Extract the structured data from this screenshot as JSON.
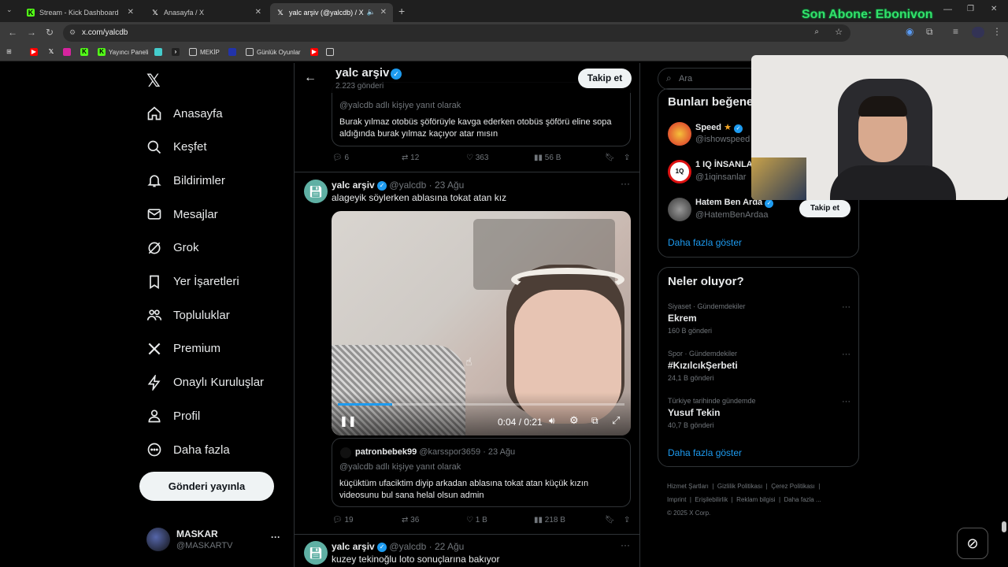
{
  "browser": {
    "tabs": [
      {
        "label": "Stream - Kick Dashboard",
        "active": false
      },
      {
        "label": "Anasayfa / X",
        "active": false
      },
      {
        "label": "yalc arşiv (@yalcdb) / X",
        "active": true
      }
    ],
    "url": "x.com/yalcdb",
    "bookmarks": [
      "Yayıncı Paneli",
      "MEKİP",
      "Günlük Oyunlar"
    ]
  },
  "overlay": {
    "text": "Son Abone: Ebonivon"
  },
  "nav": {
    "items": [
      {
        "label": "Anasayfa",
        "icon": "home-icon"
      },
      {
        "label": "Keşfet",
        "icon": "search-icon"
      },
      {
        "label": "Bildirimler",
        "icon": "bell-icon"
      },
      {
        "label": "Mesajlar",
        "icon": "mail-icon"
      },
      {
        "label": "Grok",
        "icon": "grok-icon"
      },
      {
        "label": "Yer İşaretleri",
        "icon": "bookmark-icon"
      },
      {
        "label": "Topluluklar",
        "icon": "communities-icon"
      },
      {
        "label": "Premium",
        "icon": "x-icon"
      },
      {
        "label": "Onaylı Kuruluşlar",
        "icon": "bolt-icon"
      },
      {
        "label": "Profil",
        "icon": "person-icon"
      },
      {
        "label": "Daha fazla",
        "icon": "more-circle-icon"
      }
    ],
    "post_button": "Gönderi yayınla",
    "account": {
      "name": "MASKAR",
      "handle": "@MASKARTV",
      "more": "···"
    }
  },
  "profile_header": {
    "name": "yalc arşiv",
    "posts": "2.223 gönderi",
    "follow": "Takip et"
  },
  "feed": {
    "post0": {
      "reply_to": "@yalcdb adlı kişiye yanıt olarak",
      "text": "Burak yılmaz otobüs şöförüyle kavga ederken otobüs şöförü eline sopa aldığında burak yılmaz kaçıyor atar mısın",
      "replies": "6",
      "reposts": "12",
      "likes": "363",
      "views": "56 B"
    },
    "post1": {
      "name": "yalc arşiv",
      "handle": "@yalcdb",
      "date": "· 23 Ağu",
      "more": "···",
      "text": "alageyik söylerken ablasına tokat atan kız",
      "video_time": "0:04 / 0:21",
      "video_progress": 0.19,
      "quote": {
        "name": "patronbebek99",
        "handle": "@karsspor3659",
        "date": "· 23 Ağu",
        "reply_to": "@yalcdb adlı kişiye yanıt olarak",
        "text": "küçüktüm ufaciktim diyip arkadan ablasına tokat atan küçük kızın videosunu bul sana helal olsun admin"
      },
      "replies": "19",
      "reposts": "36",
      "likes": "1 B",
      "views": "218 B"
    },
    "post2": {
      "name": "yalc arşiv",
      "handle": "@yalcdb",
      "date": "· 22 Ağu",
      "more": "···",
      "text": "kuzey tekinoğlu loto sonuçlarına bakıyor"
    }
  },
  "sidebar": {
    "search_placeholder": "Ara",
    "who_to_follow": {
      "title": "Bunları beğene",
      "users": [
        {
          "name": "Speed",
          "handle": "@ishowspeed"
        },
        {
          "name": "1 IQ İNSANLA",
          "handle": "@1iqinsanlar"
        },
        {
          "name": "Hatem Ben Arda",
          "handle": "@HatemBenArdaa",
          "button": "Takip et"
        }
      ],
      "show_more": "Daha fazla göster"
    },
    "trends": {
      "title": "Neler oluyor?",
      "items": [
        {
          "context": "Siyaset · Gündemdekiler",
          "topic": "Ekrem",
          "count": "160 B gönderi"
        },
        {
          "context": "Spor · Gündemdekiler",
          "topic": "#KızılcıkŞerbeti",
          "count": "24,1 B gönderi"
        },
        {
          "context": "Türkiye tarihinde gündemde",
          "topic": "Yusuf Tekin",
          "count": "40,7 B gönderi"
        }
      ],
      "show_more": "Daha fazla göster"
    },
    "footer": {
      "links": [
        "Hizmet Şartları",
        "Gizlilik Politikası",
        "Çerez Politikası",
        "Imprint",
        "Erişilebilirlik",
        "Reklam bilgisi",
        "Daha fazla ..."
      ],
      "copyright": "© 2025 X Corp."
    }
  },
  "colors": {
    "accent": "#1d9bf0",
    "overlay_green": "#32e16a"
  }
}
